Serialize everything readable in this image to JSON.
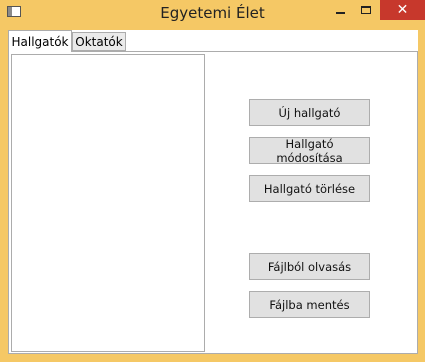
{
  "window": {
    "title": "Egyetemi Élet",
    "close_glyph": "✕"
  },
  "tabs": [
    {
      "label": "Hallgatók",
      "active": true
    },
    {
      "label": "Oktatók",
      "active": false
    }
  ],
  "buttons": {
    "new_student": "Új hallgató",
    "edit_student": "Hallgató módosítása",
    "delete_student": "Hallgató törlése",
    "read_from_file": "Fájlból olvasás",
    "save_to_file": "Fájlba mentés"
  },
  "icons": {
    "app": "window-icon",
    "minimize": "minimize-icon",
    "maximize": "maximize-icon",
    "close": "close-icon"
  },
  "colors": {
    "frame": "#f5c865",
    "close_button": "#c7382c",
    "button_face": "#e1e1e1"
  }
}
